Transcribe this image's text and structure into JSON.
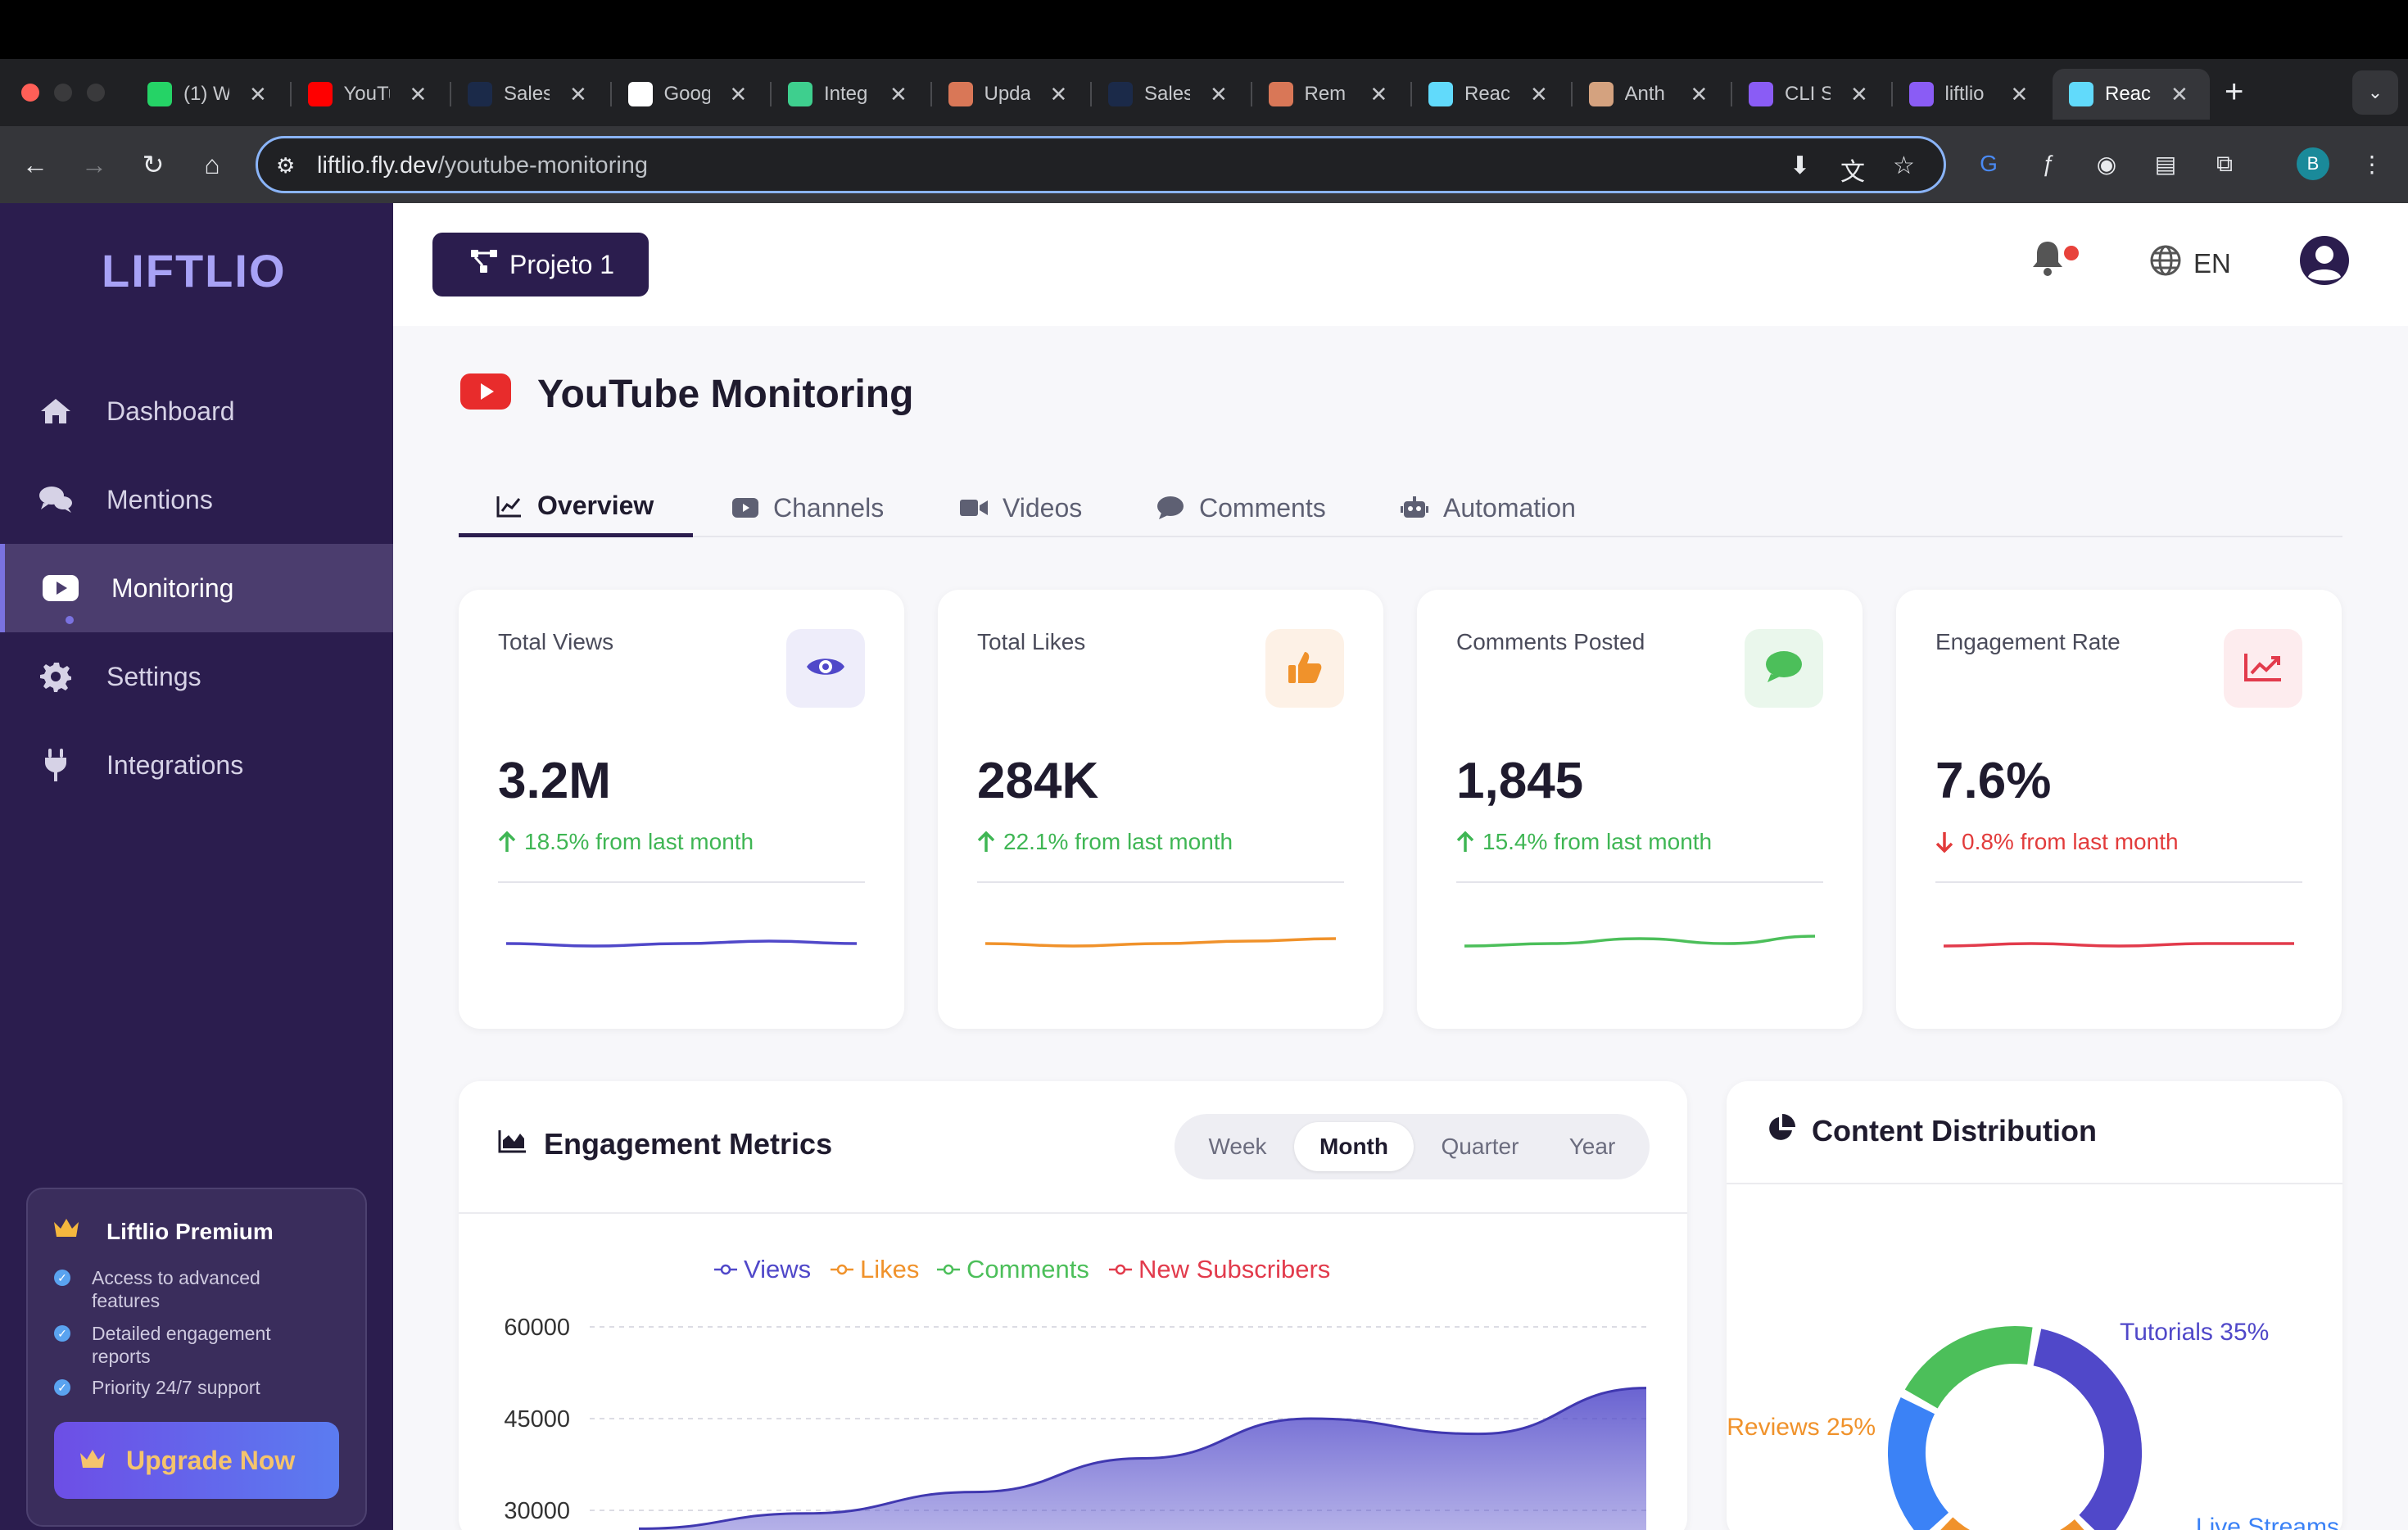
{
  "browser": {
    "tabs": [
      {
        "title": "(1) W",
        "favicon": "whatsapp-icon",
        "color": "#25d366"
      },
      {
        "title": "YouTu",
        "favicon": "youtube-icon",
        "color": "#ff0000"
      },
      {
        "title": "Sales",
        "favicon": "globe-icon",
        "color": "#1b2a49"
      },
      {
        "title": "Goog",
        "favicon": "google-icon",
        "color": "#ffffff"
      },
      {
        "title": "Integ",
        "favicon": "bolt-icon",
        "color": "#3ecf8e"
      },
      {
        "title": "Upda",
        "favicon": "sparkle-icon",
        "color": "#d97757"
      },
      {
        "title": "Sales",
        "favicon": "globe-icon",
        "color": "#1b2a49"
      },
      {
        "title": "Rem",
        "favicon": "sparkle-icon",
        "color": "#d97757"
      },
      {
        "title": "Reac",
        "favicon": "react-icon",
        "color": "#61dafb"
      },
      {
        "title": "Anth",
        "favicon": "anthropic-icon",
        "color": "#d4a27f"
      },
      {
        "title": "CLI S",
        "favicon": "shield-icon",
        "color": "#8a5cf5"
      },
      {
        "title": "liftlio",
        "favicon": "shield-icon",
        "color": "#8a5cf5"
      },
      {
        "title": "Reac",
        "favicon": "react-icon",
        "color": "#61dafb"
      }
    ],
    "active_tab_index": 12,
    "url_host": "liftlio.fly.dev",
    "url_path": "/youtube-monitoring",
    "profile_initial": "B"
  },
  "sidebar": {
    "logo": "LIFTLIO",
    "items": [
      {
        "label": "Dashboard",
        "icon": "home-icon"
      },
      {
        "label": "Mentions",
        "icon": "chat-bubbles-icon"
      },
      {
        "label": "Monitoring",
        "icon": "youtube-icon"
      },
      {
        "label": "Settings",
        "icon": "gear-icon"
      },
      {
        "label": "Integrations",
        "icon": "plug-icon"
      }
    ],
    "active_index": 2,
    "premium": {
      "title": "Liftlio Premium",
      "features": [
        "Access to advanced features",
        "Detailed engagement reports",
        "Priority 24/7 support"
      ],
      "button": "Upgrade Now"
    }
  },
  "header": {
    "project_label": "Projeto 1",
    "language": "EN"
  },
  "page": {
    "title": "YouTube Monitoring",
    "tabs": [
      {
        "label": "Overview",
        "icon": "chart-line-icon"
      },
      {
        "label": "Channels",
        "icon": "youtube-icon"
      },
      {
        "label": "Videos",
        "icon": "video-camera-icon"
      },
      {
        "label": "Comments",
        "icon": "comment-icon"
      },
      {
        "label": "Automation",
        "icon": "robot-icon"
      }
    ],
    "active_tab": 0
  },
  "stats": [
    {
      "label": "Total Views",
      "value": "3.2M",
      "change": "18.5% from last month",
      "trend": "up",
      "icon": "eye-icon",
      "color": "#5048c9",
      "bg": "#eeedfa",
      "spark": [
        0.5,
        0.45,
        0.5,
        0.55,
        0.5
      ]
    },
    {
      "label": "Total Likes",
      "value": "284K",
      "change": "22.1% from last month",
      "trend": "up",
      "icon": "thumbs-up-icon",
      "color": "#f0922b",
      "bg": "#fdf1e6",
      "spark": [
        0.5,
        0.45,
        0.5,
        0.55,
        0.6
      ]
    },
    {
      "label": "Comments Posted",
      "value": "1,845",
      "change": "15.4% from last month",
      "trend": "up",
      "icon": "comment-icon",
      "color": "#4cbf5a",
      "bg": "#eaf7ec",
      "spark": [
        0.45,
        0.5,
        0.6,
        0.5,
        0.65
      ]
    },
    {
      "label": "Engagement Rate",
      "value": "7.6%",
      "change": "0.8% from last month",
      "trend": "down",
      "icon": "chart-up-icon",
      "color": "#e23b4c",
      "bg": "#fdecee",
      "spark": [
        0.45,
        0.5,
        0.45,
        0.5,
        0.5
      ]
    }
  ],
  "engagement": {
    "title": "Engagement Metrics",
    "periods": [
      "Week",
      "Month",
      "Quarter",
      "Year"
    ],
    "active_period": 1
  },
  "distribution": {
    "title": "Content Distribution"
  },
  "chart_data": [
    {
      "type": "area",
      "title": "Engagement Metrics",
      "legend": "top-center",
      "series": [
        {
          "name": "Views",
          "color": "#5048c9",
          "values": [
            27000,
            29500,
            33000,
            38500,
            45000,
            42500,
            50000
          ]
        },
        {
          "name": "Likes",
          "color": "#f0922b",
          "values": []
        },
        {
          "name": "Comments",
          "color": "#4cbf5a",
          "values": []
        },
        {
          "name": "New Subscribers",
          "color": "#e23b4c",
          "values": []
        }
      ],
      "y_ticks": [
        60000,
        45000,
        30000
      ],
      "ylim": [
        0,
        60000
      ],
      "grid": true
    },
    {
      "type": "pie",
      "title": "Content Distribution",
      "slices": [
        {
          "label": "Tutorials 35%",
          "value": 35,
          "color": "#5048c9"
        },
        {
          "label": "Reviews 25%",
          "value": 25,
          "color": "#f0922b"
        },
        {
          "label": "Live Streams",
          "value": 20,
          "color": "#3b82f6"
        },
        {
          "label": "",
          "value": 20,
          "color": "#4cbf5a"
        }
      ]
    }
  ]
}
